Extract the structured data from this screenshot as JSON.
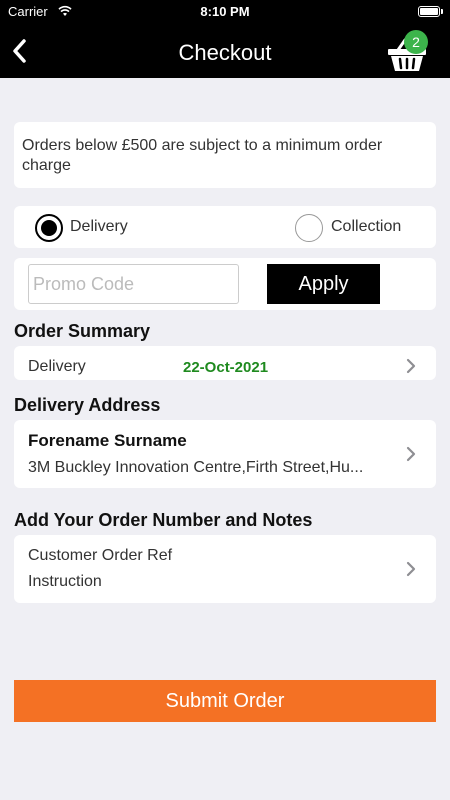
{
  "status_bar": {
    "carrier": "Carrier",
    "time": "8:10 PM"
  },
  "header": {
    "title": "Checkout",
    "cart_count": "2"
  },
  "notice": {
    "text": "Orders below £500 are subject to a minimum order charge"
  },
  "fulfillment": {
    "delivery_label": "Delivery",
    "collection_label": "Collection",
    "selected": "Delivery"
  },
  "promo": {
    "placeholder": "Promo Code",
    "apply_label": "Apply"
  },
  "order_summary": {
    "title": "Order Summary",
    "method": "Delivery",
    "date": "22-Oct-2021"
  },
  "delivery_address": {
    "title": "Delivery Address",
    "name": "Forename Surname",
    "address": "3M Buckley Innovation Centre,Firth Street,Hu..."
  },
  "notes": {
    "title": "Add Your Order Number and Notes",
    "order_ref": "Customer Order Ref",
    "instruction": "Instruction"
  },
  "footer": {
    "submit_label": "Submit Order"
  },
  "colors": {
    "accent": "#f47124",
    "date_green": "#1f8a1f",
    "badge_green": "#3cb44b",
    "header_bg": "#000000"
  }
}
